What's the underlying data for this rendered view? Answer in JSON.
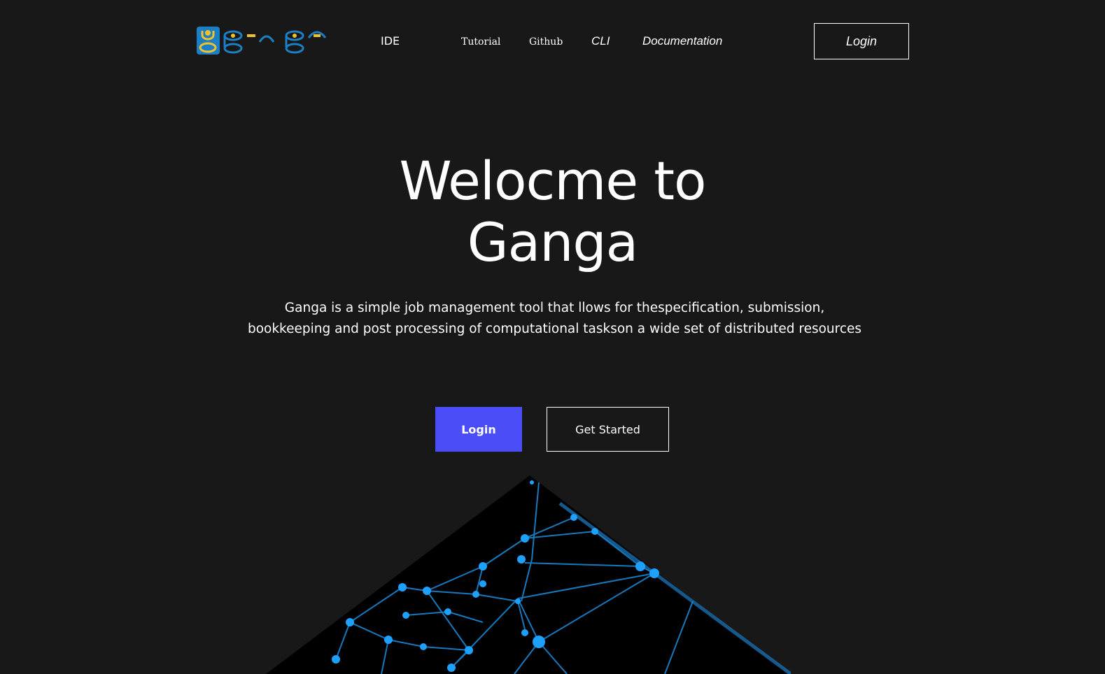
{
  "brand": {
    "logo_text": "ganga",
    "colors": {
      "blue": "#1a7fc4",
      "yellow": "#f2c12e"
    }
  },
  "nav": {
    "links": [
      {
        "label": "IDE"
      },
      {
        "label": "Tutorial"
      },
      {
        "label": "Github"
      },
      {
        "label": "CLI"
      },
      {
        "label": "Documentation"
      }
    ],
    "login_label": "Login"
  },
  "hero": {
    "title_line1": "Welocme to",
    "title_line2": "Ganga",
    "description_line1": "Ganga is a simple job management tool that llows for thespecification, submission,",
    "description_line2": "bookkeeping and post processing of computational taskson a wide set of distributed resources",
    "primary_button": "Login",
    "secondary_button": "Get Started"
  },
  "theme": {
    "background": "#181818",
    "accent": "#4b4ef7",
    "network_color": "#1ea0ff"
  },
  "illustration": {
    "icon": "network-graph-illustration"
  }
}
